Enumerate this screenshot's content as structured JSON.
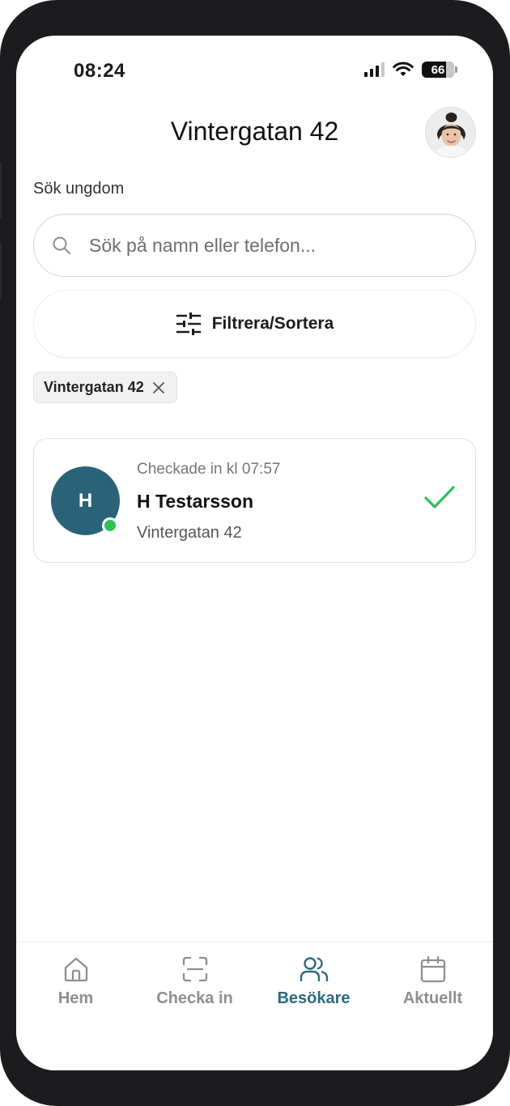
{
  "status_bar": {
    "time": "08:24",
    "battery": "66"
  },
  "header": {
    "title": "Vintergatan 42"
  },
  "search": {
    "label": "Sök ungdom",
    "placeholder": "Sök på namn eller telefon..."
  },
  "filter": {
    "label": "Filtrera/Sortera"
  },
  "active_filters": [
    {
      "label": "Vintergatan 42"
    }
  ],
  "visitors": [
    {
      "initial": "H",
      "checkin_text": "Checkade in kl 07:57",
      "name": "H Testarsson",
      "location": "Vintergatan 42",
      "online": true,
      "checked_in": true
    }
  ],
  "tabs": [
    {
      "label": "Hem",
      "icon": "home-icon",
      "active": false
    },
    {
      "label": "Checka in",
      "icon": "scan-icon",
      "active": false
    },
    {
      "label": "Besökare",
      "icon": "users-icon",
      "active": true
    },
    {
      "label": "Aktuellt",
      "icon": "calendar-icon",
      "active": false
    }
  ],
  "colors": {
    "accent": "#2d6a80",
    "avatar_bg": "#2a6378",
    "online": "#2ec157",
    "check": "#2ec157",
    "inactive_tab": "#8e8e93"
  }
}
